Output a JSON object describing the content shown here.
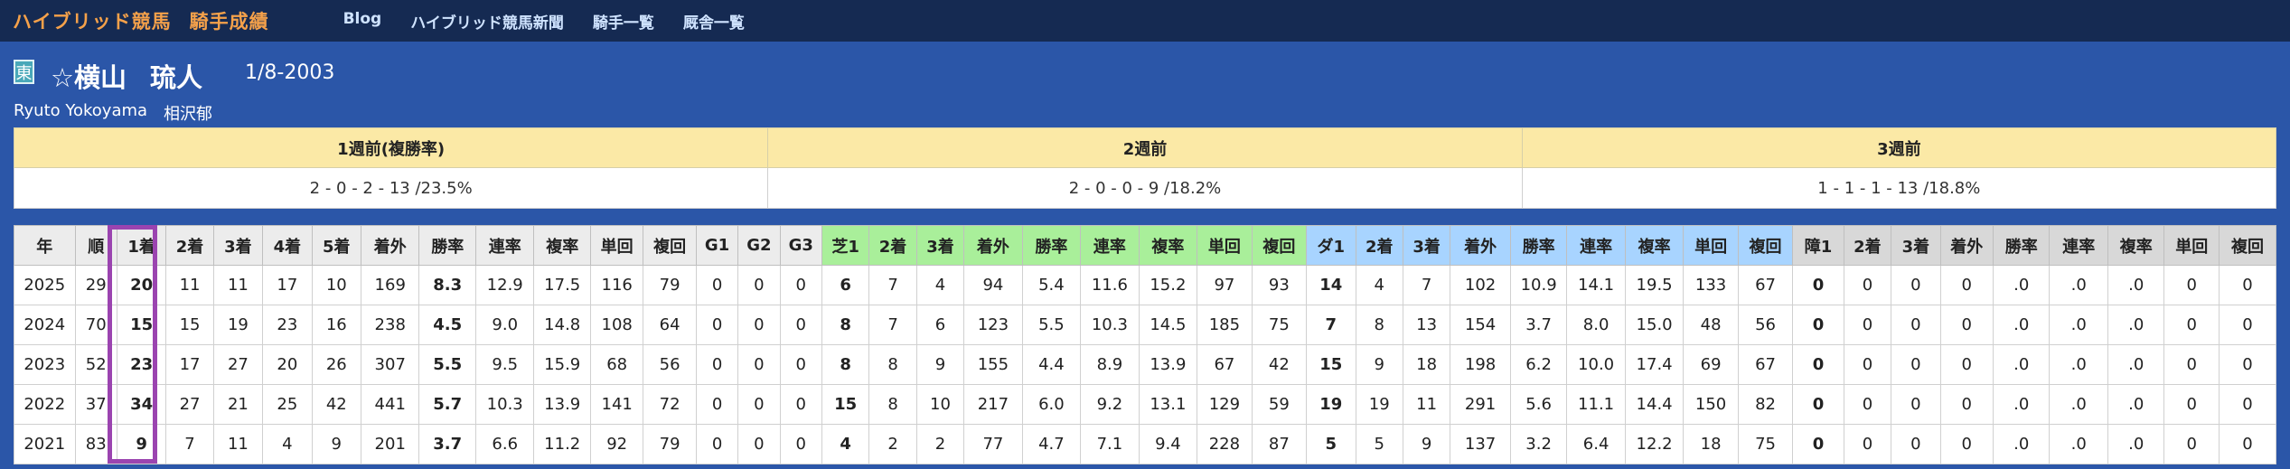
{
  "nav": {
    "brand_part1": "ハイブリッド競馬",
    "brand_part2": "騎手成績",
    "links": [
      "Blog",
      "ハイブリッド競馬新聞",
      "騎手一覧",
      "厩舎一覧"
    ]
  },
  "jockey": {
    "affiliation_badge": "東",
    "name_family": "☆横山",
    "name_given": "琉人",
    "birthdate": "1/8-2003",
    "romaji": "Ryuto Yokoyama",
    "stable": "相沢郁"
  },
  "weeks": {
    "headers": [
      "1週前(複勝率)",
      "2週前",
      "3週前"
    ],
    "values": [
      "2 - 0 - 2 - 13 /23.5%",
      "2 - 0 - 0 - 9 /18.2%",
      "1 - 1 - 1 - 13 /18.8%"
    ]
  },
  "stats": {
    "headers": [
      "年",
      "順",
      "1着",
      "2着",
      "3着",
      "4着",
      "5着",
      "着外",
      "勝率",
      "連率",
      "複率",
      "単回",
      "複回",
      "G1",
      "G2",
      "G3",
      "芝1",
      "2着",
      "3着",
      "着外",
      "勝率",
      "連率",
      "複率",
      "単回",
      "複回",
      "ダ1",
      "2着",
      "3着",
      "着外",
      "勝率",
      "連率",
      "複率",
      "単回",
      "複回",
      "障1",
      "2着",
      "3着",
      "着外",
      "勝率",
      "連率",
      "複率",
      "単回",
      "複回"
    ],
    "rows": [
      [
        "2025",
        "29",
        "20",
        "11",
        "11",
        "17",
        "10",
        "169",
        "8.3",
        "12.9",
        "17.5",
        "116",
        "79",
        "0",
        "0",
        "0",
        "6",
        "7",
        "4",
        "94",
        "5.4",
        "11.6",
        "15.2",
        "97",
        "93",
        "14",
        "4",
        "7",
        "102",
        "10.9",
        "14.1",
        "19.5",
        "133",
        "67",
        "0",
        "0",
        "0",
        "0",
        ".0",
        ".0",
        ".0",
        "0",
        "0"
      ],
      [
        "2024",
        "70",
        "15",
        "15",
        "19",
        "23",
        "16",
        "238",
        "4.5",
        "9.0",
        "14.8",
        "108",
        "64",
        "0",
        "0",
        "0",
        "8",
        "7",
        "6",
        "123",
        "5.5",
        "10.3",
        "14.5",
        "185",
        "75",
        "7",
        "8",
        "13",
        "154",
        "3.7",
        "8.0",
        "15.0",
        "48",
        "56",
        "0",
        "0",
        "0",
        "0",
        ".0",
        ".0",
        ".0",
        "0",
        "0"
      ],
      [
        "2023",
        "52",
        "23",
        "17",
        "27",
        "20",
        "26",
        "307",
        "5.5",
        "9.5",
        "15.9",
        "68",
        "56",
        "0",
        "0",
        "0",
        "8",
        "8",
        "9",
        "155",
        "4.4",
        "8.9",
        "13.9",
        "67",
        "42",
        "15",
        "9",
        "18",
        "198",
        "6.2",
        "10.0",
        "17.4",
        "69",
        "67",
        "0",
        "0",
        "0",
        "0",
        ".0",
        ".0",
        ".0",
        "0",
        "0"
      ],
      [
        "2022",
        "37",
        "34",
        "27",
        "21",
        "25",
        "42",
        "441",
        "5.7",
        "10.3",
        "13.9",
        "141",
        "72",
        "0",
        "0",
        "0",
        "15",
        "8",
        "10",
        "217",
        "6.0",
        "9.2",
        "13.1",
        "129",
        "59",
        "19",
        "19",
        "11",
        "291",
        "5.6",
        "11.1",
        "14.4",
        "150",
        "82",
        "0",
        "0",
        "0",
        "0",
        ".0",
        ".0",
        ".0",
        "0",
        "0"
      ],
      [
        "2021",
        "83",
        "9",
        "7",
        "11",
        "4",
        "9",
        "201",
        "3.7",
        "6.6",
        "11.2",
        "92",
        "79",
        "0",
        "0",
        "0",
        "4",
        "2",
        "2",
        "77",
        "4.7",
        "7.1",
        "9.4",
        "228",
        "87",
        "5",
        "5",
        "9",
        "137",
        "3.2",
        "6.4",
        "12.2",
        "18",
        "75",
        "0",
        "0",
        "0",
        "0",
        ".0",
        ".0",
        ".0",
        "0",
        "0"
      ]
    ]
  }
}
